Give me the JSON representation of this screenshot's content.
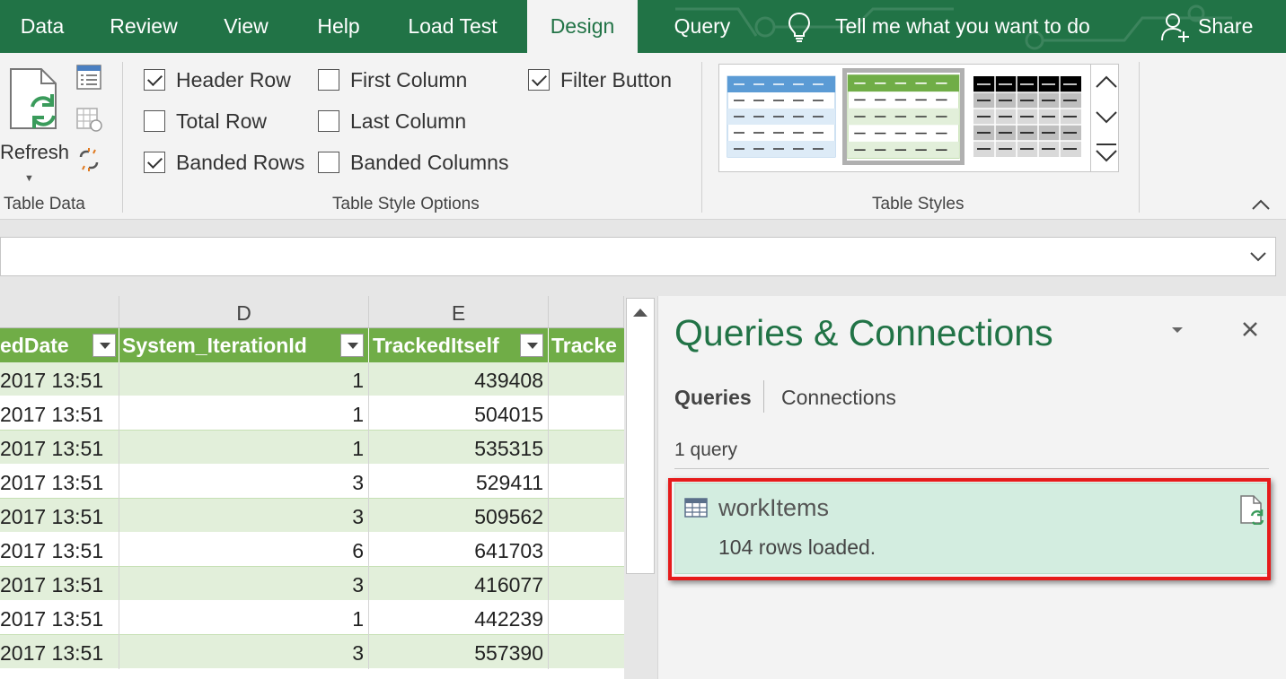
{
  "tabs": [
    {
      "label": "Data"
    },
    {
      "label": "Review"
    },
    {
      "label": "View"
    },
    {
      "label": "Help"
    },
    {
      "label": "Load Test"
    },
    {
      "label": "Design"
    },
    {
      "label": "Query"
    }
  ],
  "active_tab": "Design",
  "tell_me": "Tell me what you want to do",
  "share": "Share",
  "ribbon": {
    "table_data": {
      "refresh_label": "Refresh",
      "group_label": "Table Data"
    },
    "style_options": {
      "group_label": "Table Style Options",
      "header_row": {
        "label": "Header Row",
        "checked": true
      },
      "total_row": {
        "label": "Total Row",
        "checked": false
      },
      "banded_rows": {
        "label": "Banded Rows",
        "checked": true
      },
      "first_column": {
        "label": "First Column",
        "checked": false
      },
      "last_column": {
        "label": "Last Column",
        "checked": false
      },
      "banded_columns": {
        "label": "Banded Columns",
        "checked": false
      },
      "filter_button": {
        "label": "Filter Button",
        "checked": true
      }
    },
    "table_styles": {
      "group_label": "Table Styles",
      "selected": "green"
    }
  },
  "sheet": {
    "columns": [
      {
        "letter": "D"
      },
      {
        "letter": "E"
      }
    ],
    "headers": [
      "edDate",
      "System_IterationId",
      "TrackedItself",
      "Tracke"
    ],
    "rows": [
      [
        "2017 13:51",
        "1",
        "439408"
      ],
      [
        "2017 13:51",
        "1",
        "504015"
      ],
      [
        "2017 13:51",
        "1",
        "535315"
      ],
      [
        "2017 13:51",
        "3",
        "529411"
      ],
      [
        "2017 13:51",
        "3",
        "509562"
      ],
      [
        "2017 13:51",
        "6",
        "641703"
      ],
      [
        "2017 13:51",
        "3",
        "416077"
      ],
      [
        "2017 13:51",
        "1",
        "442239"
      ],
      [
        "2017 13:51",
        "3",
        "557390"
      ]
    ]
  },
  "pane": {
    "title": "Queries & Connections",
    "tab_queries": "Queries",
    "tab_connections": "Connections",
    "count": "1 query",
    "query": {
      "name": "workItems",
      "status": "104 rows loaded."
    }
  },
  "colors": {
    "excel_green": "#217346",
    "table_header": "#70ad47",
    "band": "#e2efda",
    "query_card": "#d3ede0",
    "highlight": "#e61b1b"
  }
}
